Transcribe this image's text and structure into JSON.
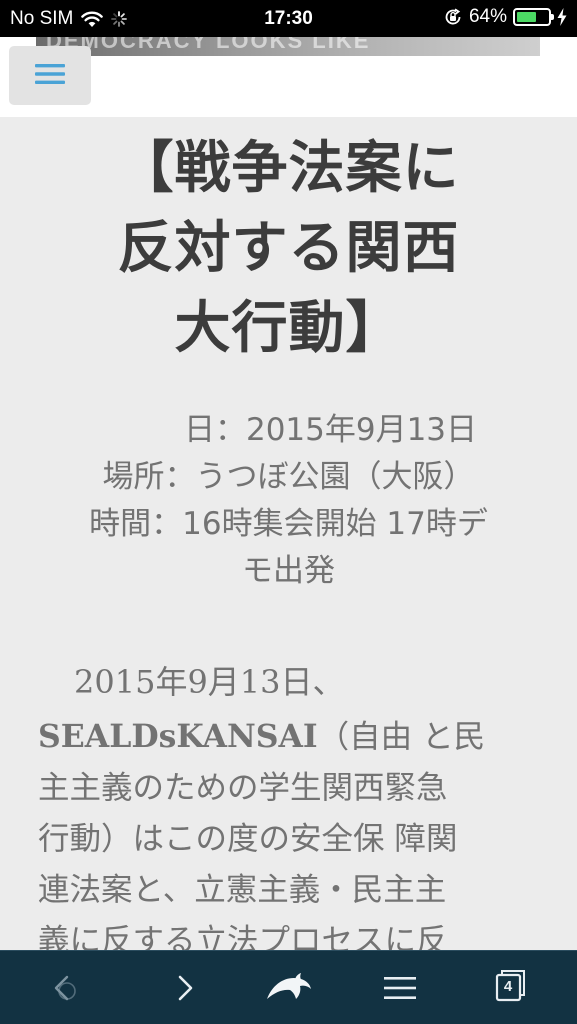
{
  "status_bar": {
    "carrier": "No SIM",
    "time": "17:30",
    "battery_percent_label": "64%",
    "battery_level": 0.64,
    "wifi_icon": "wifi-icon",
    "activity_icon": "activity-spinner-icon",
    "orientation_lock_icon": "orientation-lock-icon",
    "charging_icon": "lightning-bolt-icon"
  },
  "header": {
    "menu_icon": "hamburger-menu-icon",
    "accent_color": "#4aa3d6"
  },
  "post": {
    "title_lines": [
      "【戦争法案に",
      "反対する関西",
      "大行動】"
    ],
    "event_info_lines": [
      "日：2015年9月13日",
      "場所：うつぼ公園（大阪）",
      "時間：16時集会開始 17時デ",
      "モ出発"
    ],
    "intro_date": "2015年9月13日、",
    "intro_org": "SEALDsKANSAI",
    "intro_lines": [
      "（自由 と民",
      "主主義のための学生関西緊急",
      "行動）はこの度の安全保 障関",
      "連法案と、立憲主義・民主主",
      "義に反する立法プロセスに反"
    ]
  },
  "toolbar": {
    "back_icon": "chevron-left-icon",
    "forward_icon": "chevron-right-icon",
    "home_icon": "dolphin-logo-icon",
    "menu_icon": "hamburger-menu-icon",
    "tabs_icon": "tabs-icon",
    "tab_count": "4",
    "background_color": "#123242"
  }
}
